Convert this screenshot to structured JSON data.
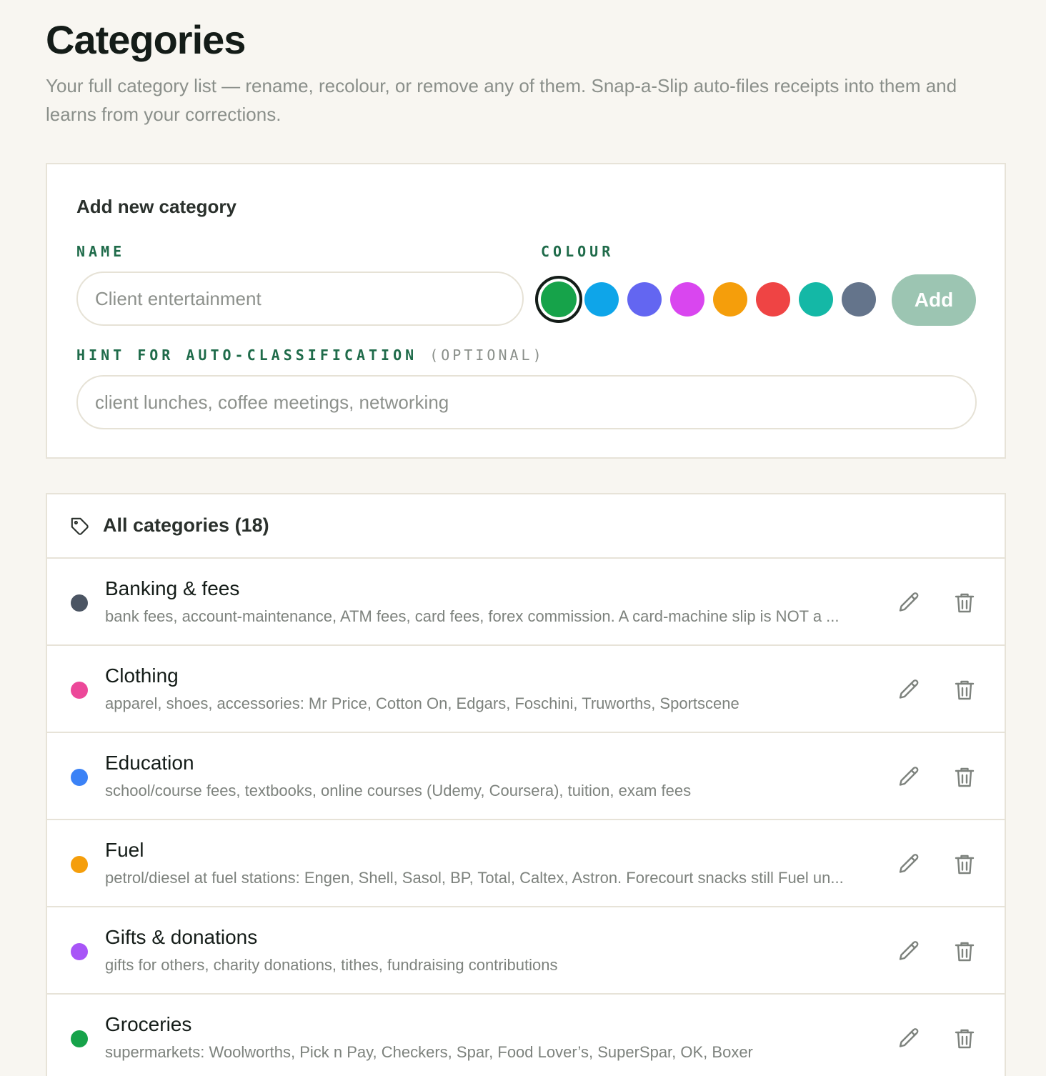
{
  "header": {
    "title": "Categories",
    "subtitle": "Your full category list — rename, recolour, or remove any of them. Snap-a-Slip auto-files receipts into them and learns from your corrections."
  },
  "add_form": {
    "title": "Add new category",
    "name_label": "NAME",
    "name_placeholder": "Client entertainment",
    "colour_label": "COLOUR",
    "hint_label": "HINT FOR AUTO-CLASSIFICATION",
    "hint_optional": "(OPTIONAL)",
    "hint_placeholder": "client lunches, coffee meetings, networking",
    "add_label": "Add",
    "colours": [
      "#16a34a",
      "#0ea5e9",
      "#6366f1",
      "#d946ef",
      "#f59e0b",
      "#ef4444",
      "#14b8a6",
      "#64748b"
    ],
    "selected_colour_index": 0,
    "add_button_color": "#9cc5b2"
  },
  "list": {
    "title": "All categories (18)",
    "icon": "tag-icon",
    "items": [
      {
        "name": "Banking & fees",
        "hint": "bank fees, account-maintenance, ATM fees, card fees, forex commission. A card-machine slip is NOT a ...",
        "color": "#4b5563"
      },
      {
        "name": "Clothing",
        "hint": "apparel, shoes, accessories: Mr Price, Cotton On, Edgars, Foschini, Truworths, Sportscene",
        "color": "#ec4899"
      },
      {
        "name": "Education",
        "hint": "school/course fees, textbooks, online courses (Udemy, Coursera), tuition, exam fees",
        "color": "#3b82f6"
      },
      {
        "name": "Fuel",
        "hint": "petrol/diesel at fuel stations: Engen, Shell, Sasol, BP, Total, Caltex, Astron. Forecourt snacks still Fuel un...",
        "color": "#f59e0b"
      },
      {
        "name": "Gifts & donations",
        "hint": "gifts for others, charity donations, tithes, fundraising contributions",
        "color": "#a855f7"
      },
      {
        "name": "Groceries",
        "hint": "supermarkets: Woolworths, Pick n Pay, Checkers, Spar, Food Lover’s, SuperSpar, OK, Boxer",
        "color": "#16a34a"
      }
    ],
    "row_icons": [
      "pencil-icon",
      "trash-icon"
    ]
  },
  "colors": {
    "background": "#f8f6f1",
    "accent_label": "#1f6b4a",
    "card_border": "#e7e3d8"
  }
}
